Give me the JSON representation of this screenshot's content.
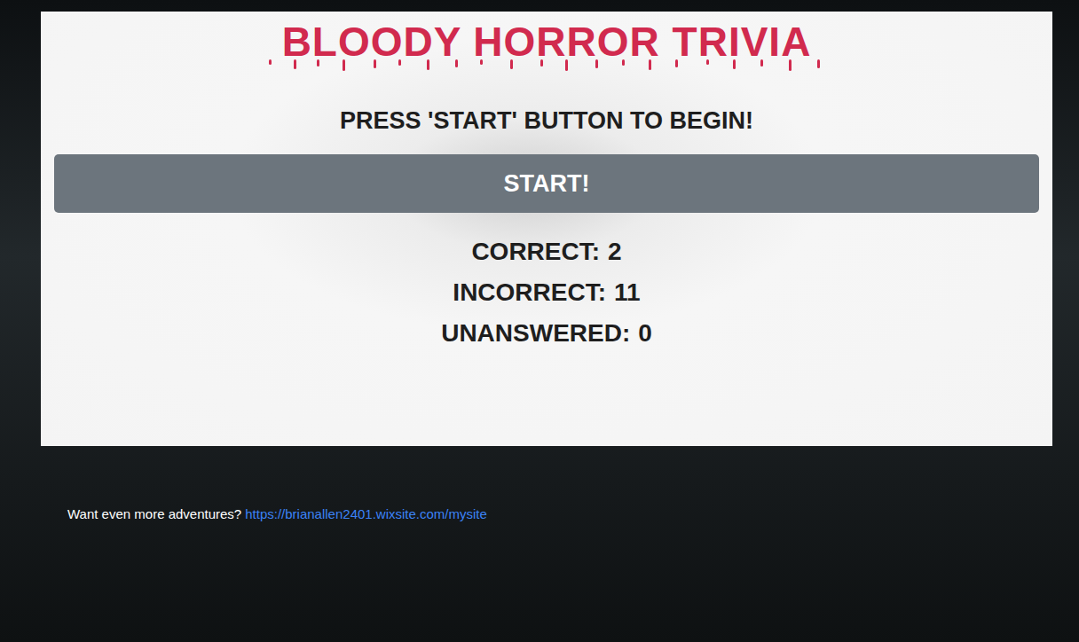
{
  "title": "BLOODY HORROR TRIVIA",
  "prompt": "PRESS 'START' BUTTON TO BEGIN!",
  "start_button": "START!",
  "scores": [
    {
      "label": "CORRECT:",
      "value": "2"
    },
    {
      "label": "INCORRECT:",
      "value": "11"
    },
    {
      "label": "UNANSWERED:",
      "value": "0"
    }
  ],
  "footer": {
    "text": "Want even more adventures?",
    "link": "https://brianallen2401.wixsite.com/mysite"
  }
}
